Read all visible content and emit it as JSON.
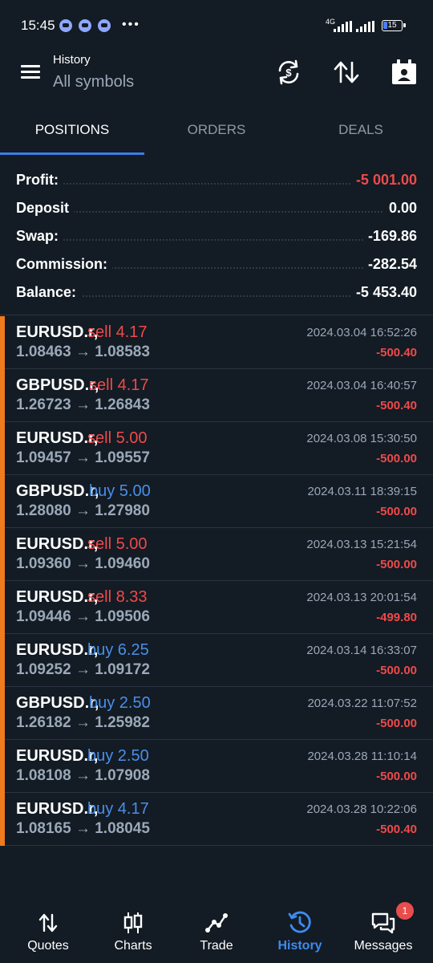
{
  "status_bar": {
    "time": "15:45",
    "network": "4G",
    "battery": "15"
  },
  "header": {
    "title": "History",
    "subtitle": "All symbols",
    "icons": [
      "sync-currency-icon",
      "sort-icon",
      "calendar-icon"
    ]
  },
  "tabs": [
    {
      "label": "POSITIONS",
      "active": true
    },
    {
      "label": "ORDERS",
      "active": false
    },
    {
      "label": "DEALS",
      "active": false
    }
  ],
  "summary": [
    {
      "label": "Profit:",
      "value": "-5 001.00",
      "negative_color": true
    },
    {
      "label": "Deposit",
      "value": "0.00",
      "negative_color": false
    },
    {
      "label": "Swap:",
      "value": "-169.86",
      "negative_color": false
    },
    {
      "label": "Commission:",
      "value": "-282.54",
      "negative_color": false
    },
    {
      "label": "Balance:",
      "value": "-5 453.40",
      "negative_color": false
    }
  ],
  "deals": [
    {
      "symbol": "EURUSD.r,",
      "side": "sell 4.17",
      "type": "sell",
      "prices": "1.08463 → 1.08583",
      "time": "2024.03.04 16:52:26",
      "pl": "-500.40"
    },
    {
      "symbol": "GBPUSD.r,",
      "side": "sell 4.17",
      "type": "sell",
      "prices": "1.26723 → 1.26843",
      "time": "2024.03.04 16:40:57",
      "pl": "-500.40"
    },
    {
      "symbol": "EURUSD.r,",
      "side": "sell 5.00",
      "type": "sell",
      "prices": "1.09457 → 1.09557",
      "time": "2024.03.08 15:30:50",
      "pl": "-500.00"
    },
    {
      "symbol": "GBPUSD.r,",
      "side": "buy 5.00",
      "type": "buy",
      "prices": "1.28080 → 1.27980",
      "time": "2024.03.11 18:39:15",
      "pl": "-500.00"
    },
    {
      "symbol": "EURUSD.r,",
      "side": "sell 5.00",
      "type": "sell",
      "prices": "1.09360 → 1.09460",
      "time": "2024.03.13 15:21:54",
      "pl": "-500.00"
    },
    {
      "symbol": "EURUSD.r,",
      "side": "sell 8.33",
      "type": "sell",
      "prices": "1.09446 → 1.09506",
      "time": "2024.03.13 20:01:54",
      "pl": "-499.80"
    },
    {
      "symbol": "EURUSD.r,",
      "side": "buy 6.25",
      "type": "buy",
      "prices": "1.09252 → 1.09172",
      "time": "2024.03.14 16:33:07",
      "pl": "-500.00"
    },
    {
      "symbol": "GBPUSD.r,",
      "side": "buy 2.50",
      "type": "buy",
      "prices": "1.26182 → 1.25982",
      "time": "2024.03.22 11:07:52",
      "pl": "-500.00"
    },
    {
      "symbol": "EURUSD.r,",
      "side": "buy 2.50",
      "type": "buy",
      "prices": "1.08108 → 1.07908",
      "time": "2024.03.28 11:10:14",
      "pl": "-500.00"
    },
    {
      "symbol": "EURUSD.r,",
      "side": "buy 4.17",
      "type": "buy",
      "prices": "1.08165 → 1.08045",
      "time": "2024.03.28 10:22:06",
      "pl": "-500.40"
    }
  ],
  "bottom_nav": [
    {
      "label": "Quotes",
      "icon": "quotes-arrows-icon",
      "active": false
    },
    {
      "label": "Charts",
      "icon": "candlestick-icon",
      "active": false
    },
    {
      "label": "Trade",
      "icon": "trade-line-icon",
      "active": false
    },
    {
      "label": "History",
      "icon": "history-clock-icon",
      "active": true
    },
    {
      "label": "Messages",
      "icon": "chat-bubbles-icon",
      "active": false,
      "badge": "1"
    }
  ],
  "colors": {
    "background": "#131b24",
    "accent": "#3d7de8",
    "loss": "#ef4a4a",
    "buy": "#4a8fe8",
    "row_marker": "#f07a1e",
    "muted": "#9aa8b8"
  }
}
